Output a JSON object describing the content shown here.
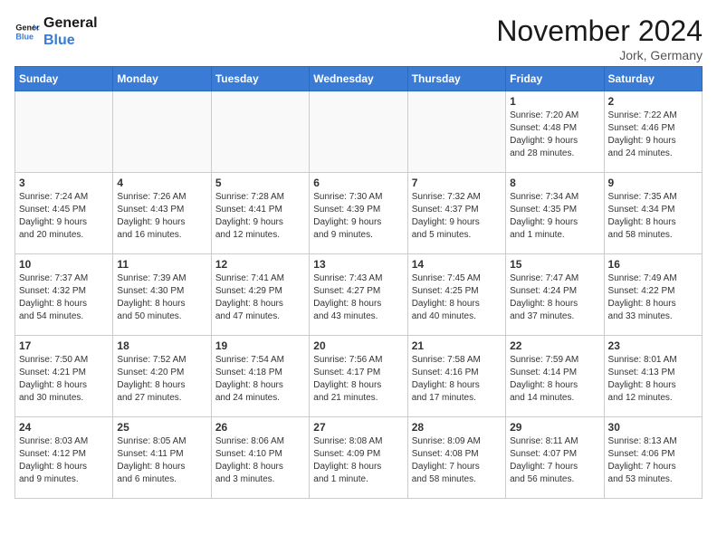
{
  "header": {
    "logo_line1": "General",
    "logo_line2": "Blue",
    "month": "November 2024",
    "location": "Jork, Germany"
  },
  "weekdays": [
    "Sunday",
    "Monday",
    "Tuesday",
    "Wednesday",
    "Thursday",
    "Friday",
    "Saturday"
  ],
  "weeks": [
    [
      {
        "day": "",
        "info": "",
        "empty": true
      },
      {
        "day": "",
        "info": "",
        "empty": true
      },
      {
        "day": "",
        "info": "",
        "empty": true
      },
      {
        "day": "",
        "info": "",
        "empty": true
      },
      {
        "day": "",
        "info": "",
        "empty": true
      },
      {
        "day": "1",
        "info": "Sunrise: 7:20 AM\nSunset: 4:48 PM\nDaylight: 9 hours\nand 28 minutes."
      },
      {
        "day": "2",
        "info": "Sunrise: 7:22 AM\nSunset: 4:46 PM\nDaylight: 9 hours\nand 24 minutes."
      }
    ],
    [
      {
        "day": "3",
        "info": "Sunrise: 7:24 AM\nSunset: 4:45 PM\nDaylight: 9 hours\nand 20 minutes."
      },
      {
        "day": "4",
        "info": "Sunrise: 7:26 AM\nSunset: 4:43 PM\nDaylight: 9 hours\nand 16 minutes."
      },
      {
        "day": "5",
        "info": "Sunrise: 7:28 AM\nSunset: 4:41 PM\nDaylight: 9 hours\nand 12 minutes."
      },
      {
        "day": "6",
        "info": "Sunrise: 7:30 AM\nSunset: 4:39 PM\nDaylight: 9 hours\nand 9 minutes."
      },
      {
        "day": "7",
        "info": "Sunrise: 7:32 AM\nSunset: 4:37 PM\nDaylight: 9 hours\nand 5 minutes."
      },
      {
        "day": "8",
        "info": "Sunrise: 7:34 AM\nSunset: 4:35 PM\nDaylight: 9 hours\nand 1 minute."
      },
      {
        "day": "9",
        "info": "Sunrise: 7:35 AM\nSunset: 4:34 PM\nDaylight: 8 hours\nand 58 minutes."
      }
    ],
    [
      {
        "day": "10",
        "info": "Sunrise: 7:37 AM\nSunset: 4:32 PM\nDaylight: 8 hours\nand 54 minutes."
      },
      {
        "day": "11",
        "info": "Sunrise: 7:39 AM\nSunset: 4:30 PM\nDaylight: 8 hours\nand 50 minutes."
      },
      {
        "day": "12",
        "info": "Sunrise: 7:41 AM\nSunset: 4:29 PM\nDaylight: 8 hours\nand 47 minutes."
      },
      {
        "day": "13",
        "info": "Sunrise: 7:43 AM\nSunset: 4:27 PM\nDaylight: 8 hours\nand 43 minutes."
      },
      {
        "day": "14",
        "info": "Sunrise: 7:45 AM\nSunset: 4:25 PM\nDaylight: 8 hours\nand 40 minutes."
      },
      {
        "day": "15",
        "info": "Sunrise: 7:47 AM\nSunset: 4:24 PM\nDaylight: 8 hours\nand 37 minutes."
      },
      {
        "day": "16",
        "info": "Sunrise: 7:49 AM\nSunset: 4:22 PM\nDaylight: 8 hours\nand 33 minutes."
      }
    ],
    [
      {
        "day": "17",
        "info": "Sunrise: 7:50 AM\nSunset: 4:21 PM\nDaylight: 8 hours\nand 30 minutes."
      },
      {
        "day": "18",
        "info": "Sunrise: 7:52 AM\nSunset: 4:20 PM\nDaylight: 8 hours\nand 27 minutes."
      },
      {
        "day": "19",
        "info": "Sunrise: 7:54 AM\nSunset: 4:18 PM\nDaylight: 8 hours\nand 24 minutes."
      },
      {
        "day": "20",
        "info": "Sunrise: 7:56 AM\nSunset: 4:17 PM\nDaylight: 8 hours\nand 21 minutes."
      },
      {
        "day": "21",
        "info": "Sunrise: 7:58 AM\nSunset: 4:16 PM\nDaylight: 8 hours\nand 17 minutes."
      },
      {
        "day": "22",
        "info": "Sunrise: 7:59 AM\nSunset: 4:14 PM\nDaylight: 8 hours\nand 14 minutes."
      },
      {
        "day": "23",
        "info": "Sunrise: 8:01 AM\nSunset: 4:13 PM\nDaylight: 8 hours\nand 12 minutes."
      }
    ],
    [
      {
        "day": "24",
        "info": "Sunrise: 8:03 AM\nSunset: 4:12 PM\nDaylight: 8 hours\nand 9 minutes."
      },
      {
        "day": "25",
        "info": "Sunrise: 8:05 AM\nSunset: 4:11 PM\nDaylight: 8 hours\nand 6 minutes."
      },
      {
        "day": "26",
        "info": "Sunrise: 8:06 AM\nSunset: 4:10 PM\nDaylight: 8 hours\nand 3 minutes."
      },
      {
        "day": "27",
        "info": "Sunrise: 8:08 AM\nSunset: 4:09 PM\nDaylight: 8 hours\nand 1 minute."
      },
      {
        "day": "28",
        "info": "Sunrise: 8:09 AM\nSunset: 4:08 PM\nDaylight: 7 hours\nand 58 minutes."
      },
      {
        "day": "29",
        "info": "Sunrise: 8:11 AM\nSunset: 4:07 PM\nDaylight: 7 hours\nand 56 minutes."
      },
      {
        "day": "30",
        "info": "Sunrise: 8:13 AM\nSunset: 4:06 PM\nDaylight: 7 hours\nand 53 minutes."
      }
    ]
  ]
}
